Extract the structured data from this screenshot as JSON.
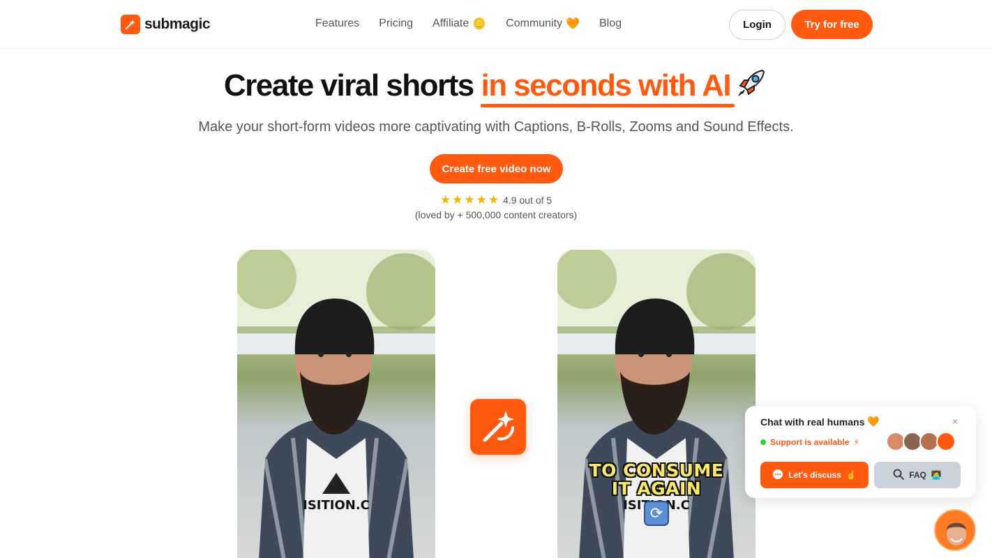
{
  "brand": {
    "name": "submagic",
    "accent": "#ff5a0f"
  },
  "nav": {
    "items": [
      {
        "label": "Features",
        "emoji": ""
      },
      {
        "label": "Pricing",
        "emoji": ""
      },
      {
        "label": "Affiliate",
        "emoji": "🪙"
      },
      {
        "label": "Community",
        "emoji": "🧡"
      },
      {
        "label": "Blog",
        "emoji": ""
      }
    ],
    "login": "Login",
    "try": "Try for free"
  },
  "hero": {
    "title_plain": "Create viral shorts ",
    "title_accent": "in seconds with AI",
    "title_emoji": "rocket-icon",
    "subtitle": "Make your short-form videos more captivating with Captions, B-Rolls, Zooms and Sound Effects.",
    "cta": "Create free video now",
    "rating": "4.9 out of 5",
    "stars": 5,
    "loved": "(loved by + 500,000 content creators)"
  },
  "video_right": {
    "caption_line1": "TO CONSUME",
    "caption_line2": "IT AGAIN",
    "caption_color": "#fce96a"
  },
  "chat": {
    "title": "Chat with real humans",
    "title_emoji": "🧡",
    "support": "Support is available",
    "support_emoji": "⚡",
    "discuss": "Let's discuss",
    "discuss_emoji": "☝",
    "faq": "FAQ",
    "faq_emoji": "🧑‍💻",
    "close": "×"
  }
}
